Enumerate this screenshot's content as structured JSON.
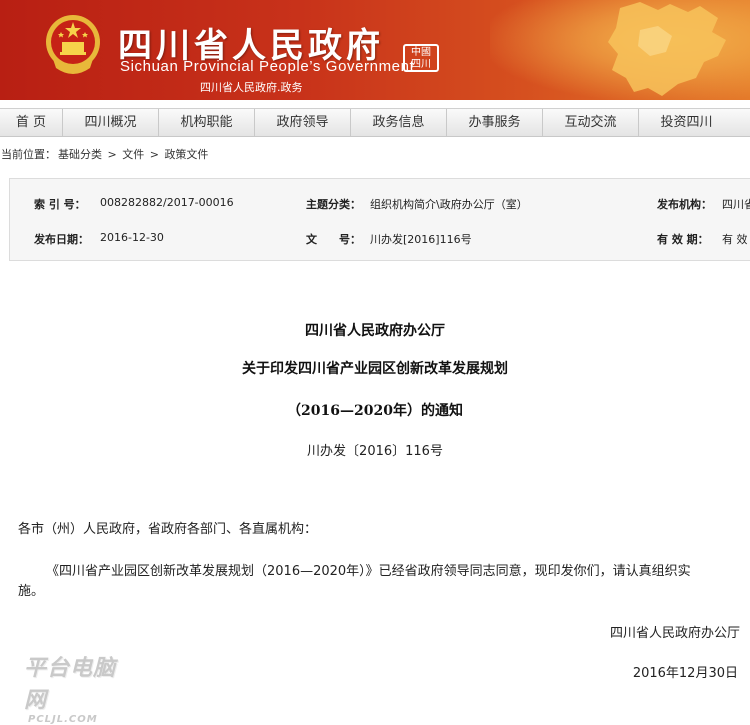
{
  "header": {
    "title": "四川省人民政府",
    "subtitle": "Sichuan Provincial People’s Government",
    "domain": "四川省人民政府.政务",
    "seal_text": "中国四川"
  },
  "nav": [
    {
      "label": "首 页"
    },
    {
      "label": "四川概况"
    },
    {
      "label": "机构职能"
    },
    {
      "label": "政府领导"
    },
    {
      "label": "政务信息"
    },
    {
      "label": "办事服务"
    },
    {
      "label": "互动交流"
    },
    {
      "label": "投资四川"
    }
  ],
  "breadcrumb": {
    "prefix": "当前位置：",
    "items": [
      "基础分类",
      "文件",
      "政策文件"
    ],
    "separator": ">"
  },
  "info": {
    "index_label": "索 引 号：",
    "index_value": "008282882/2017-00016",
    "topic_label": "主题分类：",
    "topic_value": "组织机构简介\\政府办公厅（室）",
    "publisher_label": "发布机构：",
    "publisher_value": "四川省",
    "date_label": "发布日期：",
    "date_value": "2016-12-30",
    "docno_label": "文　　号：",
    "docno_value": "川办发[2016]116号",
    "validity_label": "有 效 期：",
    "validity_value": "有 效"
  },
  "document": {
    "title_line1": "四川省人民政府办公厅",
    "title_line2": "关于印发四川省产业园区创新改革发展规划",
    "title_line3": "（2016—2020年）的通知",
    "doc_number": "川办发〔2016〕116号",
    "salutation": "各市（州）人民政府，省政府各部门、各直属机构：",
    "body_line1": "《四川省产业园区创新改革发展规划（2016—2020年）》已经省政府领导同志同意，现印发你们，请认真组织实",
    "body_line2": "施。",
    "signature": "四川省人民政府办公厅",
    "date": "2016年12月30日"
  },
  "watermark": {
    "line1": "平台电脑网",
    "line2": "PCLJL.COM"
  },
  "colors": {
    "header_red": "#b81f13",
    "header_orange": "#e47a2a",
    "nav_bg": "#ececec",
    "info_bg": "#f6f6f6"
  }
}
